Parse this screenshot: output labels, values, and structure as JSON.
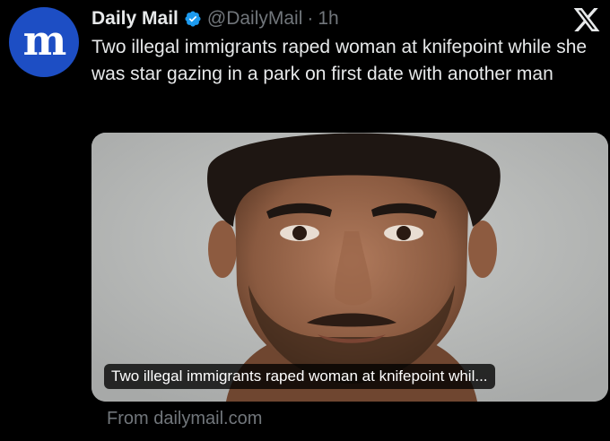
{
  "post": {
    "author_name": "Daily Mail",
    "handle": "@DailyMail",
    "separator": "·",
    "time": "1h",
    "avatar_letter": "m",
    "text": "Two illegal immigrants raped woman at knifepoint while she was star gazing in a park on first date with another man"
  },
  "link_card": {
    "title": "Two illegal immigrants raped woman at knifepoint whil...",
    "source": "From dailymail.com"
  },
  "icons": {
    "verified": "verified-badge-icon",
    "platform": "x-logo-icon"
  },
  "colors": {
    "background": "#000000",
    "text": "#e7e9ea",
    "muted": "#71767b",
    "verified": "#1d9bf0",
    "avatar": "#1d4ec4"
  }
}
